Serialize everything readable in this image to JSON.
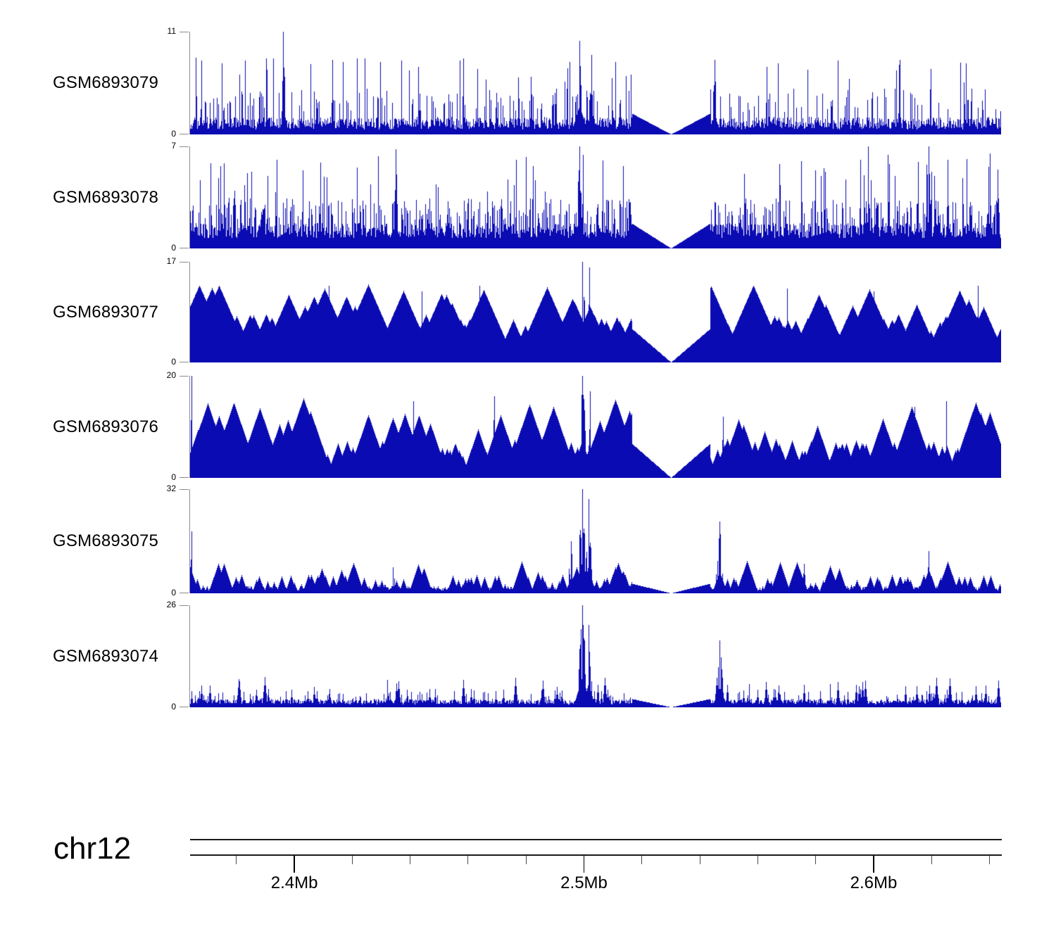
{
  "chart_data": {
    "type": "area",
    "chromosome_label": "chr12",
    "signal_color": "#0b0bb4",
    "axis_color": "#8c8c8c",
    "x_axis": {
      "unit": "Mb",
      "min_mb": 2.364,
      "max_mb": 2.644,
      "major_ticks": [
        {
          "mb": 2.4,
          "label": "2.4Mb"
        },
        {
          "mb": 2.5,
          "label": "2.5Mb"
        },
        {
          "mb": 2.6,
          "label": "2.6Mb"
        }
      ],
      "minor_ticks_mb": [
        2.38,
        2.42,
        2.44,
        2.46,
        2.48,
        2.52,
        2.54,
        2.56,
        2.58,
        2.62,
        2.64
      ]
    },
    "coverage_gap": {
      "center_mb": 2.53,
      "half_width_mb": 0.0134
    },
    "tracks": [
      {
        "name": "GSM6893079",
        "ymax": 11,
        "y_min": 0,
        "peaks": [
          {
            "mb": 2.396,
            "value": 11,
            "hw": 2,
            "n": 3
          },
          {
            "mb": 2.413,
            "value": 8,
            "hw": 2,
            "n": 3
          },
          {
            "mb": 2.4985,
            "value": 10,
            "hw": 6,
            "n": 8
          },
          {
            "mb": 2.5025,
            "value": 8.5,
            "hw": 4,
            "n": 6
          },
          {
            "mb": 2.545,
            "value": 8,
            "hw": 3,
            "n": 4
          },
          {
            "mb": 2.609,
            "value": 8,
            "hw": 2,
            "n": 3
          }
        ],
        "render": {
          "seed": 79,
          "base": 0.05,
          "noise": 0.12,
          "mid_p": 0.18,
          "mid_lo": 0.22,
          "mid_hi": 0.45,
          "tall_p": 0.035,
          "tall_lo": 0.5,
          "tall_hi": 0.75,
          "slope": 1,
          "gap_edge": 0.2
        }
      },
      {
        "name": "GSM6893078",
        "ymax": 7,
        "y_min": 0,
        "peaks": [
          {
            "mb": 2.435,
            "value": 6.8,
            "hw": 3,
            "n": 4
          },
          {
            "mb": 2.4985,
            "value": 7,
            "hw": 5,
            "n": 7
          },
          {
            "mb": 2.598,
            "value": 7,
            "hw": 3,
            "n": 4
          },
          {
            "mb": 2.619,
            "value": 7,
            "hw": 3,
            "n": 4
          },
          {
            "mb": 2.64,
            "value": 6.5,
            "hw": 3,
            "n": 4
          }
        ],
        "render": {
          "seed": 78,
          "base": 0.1,
          "noise": 0.15,
          "mid_p": 0.32,
          "mid_lo": 0.28,
          "mid_hi": 0.5,
          "tall_p": 0.06,
          "tall_lo": 0.55,
          "tall_hi": 0.92,
          "slope": 1,
          "gap_edge": 0.24
        }
      },
      {
        "name": "GSM6893077",
        "ymax": 17,
        "y_min": 0,
        "peaks": [
          {
            "mb": 2.4995,
            "value": 17,
            "hw": 5,
            "n": 6
          },
          {
            "mb": 2.5018,
            "value": 16,
            "hw": 4,
            "n": 5
          },
          {
            "mb": 2.412,
            "value": 13,
            "hw": 3,
            "n": 3
          },
          {
            "mb": 2.444,
            "value": 12,
            "hw": 2,
            "n": 3
          },
          {
            "mb": 2.464,
            "value": 13,
            "hw": 3,
            "n": 3
          },
          {
            "mb": 2.57,
            "value": 12.5,
            "hw": 3,
            "n": 3
          },
          {
            "mb": 2.6,
            "value": 12,
            "hw": 3,
            "n": 3
          },
          {
            "mb": 2.636,
            "value": 13,
            "hw": 2,
            "n": 3
          }
        ],
        "render": {
          "seed": 77,
          "base": 0.04,
          "noise": 0.1,
          "mid_p": 0.2,
          "mid_lo": 0.25,
          "mid_hi": 0.48,
          "tall_p": 0.03,
          "tall_lo": 0.55,
          "tall_hi": 0.78,
          "slope": 0.016,
          "gap_edge": 0.33
        }
      },
      {
        "name": "GSM6893076",
        "ymax": 20,
        "y_min": 0,
        "peaks": [
          {
            "mb": 2.3645,
            "value": 20,
            "hw": 2,
            "n": 2
          },
          {
            "mb": 2.4995,
            "value": 20,
            "hw": 6,
            "n": 8
          },
          {
            "mb": 2.502,
            "value": 17,
            "hw": 4,
            "n": 5
          },
          {
            "mb": 2.441,
            "value": 15,
            "hw": 2,
            "n": 3
          },
          {
            "mb": 2.469,
            "value": 16,
            "hw": 3,
            "n": 4
          },
          {
            "mb": 2.548,
            "value": 12,
            "hw": 2,
            "n": 3
          },
          {
            "mb": 2.614,
            "value": 14,
            "hw": 3,
            "n": 4
          },
          {
            "mb": 2.625,
            "value": 15,
            "hw": 2,
            "n": 3
          }
        ],
        "render": {
          "seed": 76,
          "base": 0.03,
          "noise": 0.08,
          "mid_p": 0.16,
          "mid_lo": 0.18,
          "mid_hi": 0.38,
          "tall_p": 0.04,
          "tall_lo": 0.45,
          "tall_hi": 0.78,
          "slope": 0.02,
          "gap_edge": 0.33
        }
      },
      {
        "name": "GSM6893075",
        "ymax": 32,
        "y_min": 0,
        "peaks": [
          {
            "mb": 2.3645,
            "value": 19,
            "hw": 2,
            "n": 2
          },
          {
            "mb": 2.434,
            "value": 8,
            "hw": 3,
            "n": 4
          },
          {
            "mb": 2.4955,
            "value": 16,
            "hw": 4,
            "n": 5
          },
          {
            "mb": 2.4995,
            "value": 32,
            "hw": 6,
            "n": 10
          },
          {
            "mb": 2.5015,
            "value": 29,
            "hw": 4,
            "n": 6
          },
          {
            "mb": 2.5468,
            "value": 22,
            "hw": 5,
            "n": 7
          },
          {
            "mb": 2.576,
            "value": 9,
            "hw": 3,
            "n": 4
          },
          {
            "mb": 2.619,
            "value": 13,
            "hw": 3,
            "n": 4
          }
        ],
        "render": {
          "seed": 75,
          "base": 0.02,
          "noise": 0.05,
          "mid_p": 0.1,
          "mid_lo": 0.07,
          "mid_hi": 0.18,
          "tall_p": 0.02,
          "tall_lo": 0.2,
          "tall_hi": 0.33,
          "slope": 0.02,
          "gap_edge": 0.09
        }
      },
      {
        "name": "GSM6893074",
        "ymax": 26,
        "y_min": 0,
        "peaks": [
          {
            "mb": 2.432,
            "value": 7,
            "hw": 3,
            "n": 4
          },
          {
            "mb": 2.4995,
            "value": 26,
            "hw": 6,
            "n": 10
          },
          {
            "mb": 2.5015,
            "value": 21,
            "hw": 4,
            "n": 6
          },
          {
            "mb": 2.5468,
            "value": 17,
            "hw": 5,
            "n": 8
          },
          {
            "mb": 2.557,
            "value": 6,
            "hw": 3,
            "n": 4
          },
          {
            "mb": 2.585,
            "value": 6,
            "hw": 3,
            "n": 4
          }
        ],
        "render": {
          "seed": 74,
          "base": 0.03,
          "noise": 0.05,
          "mid_p": 0.14,
          "mid_lo": 0.08,
          "mid_hi": 0.18,
          "tall_p": 0.025,
          "tall_lo": 0.2,
          "tall_hi": 0.3,
          "slope": 0.08,
          "gap_edge": 0.08
        }
      }
    ]
  }
}
